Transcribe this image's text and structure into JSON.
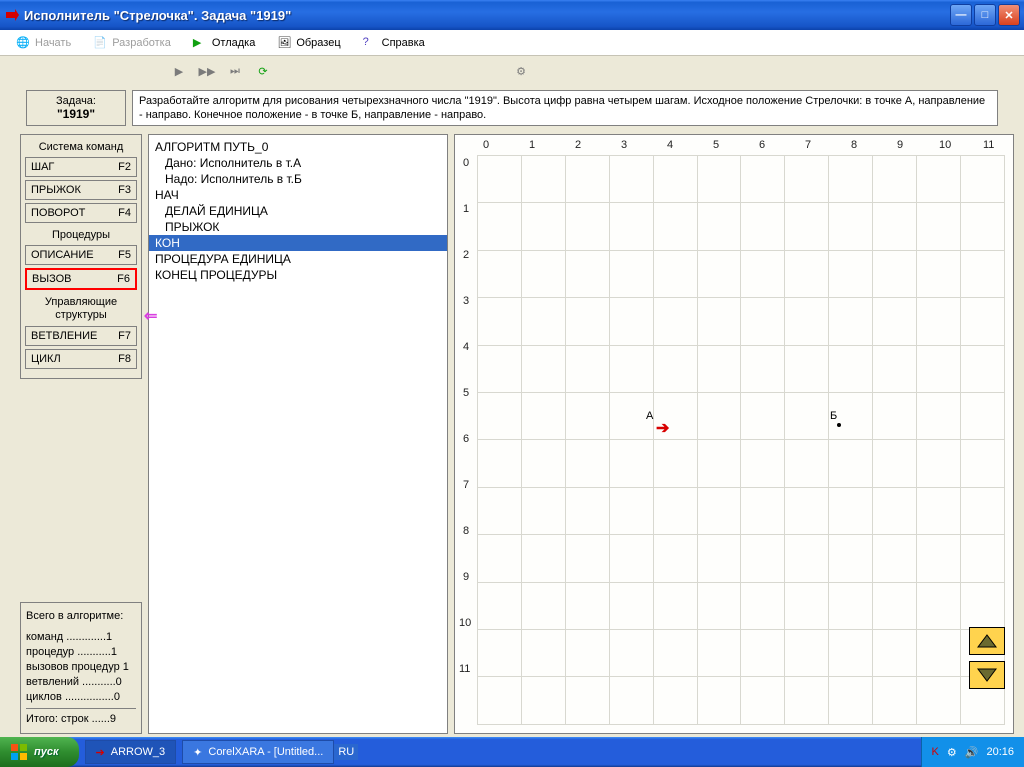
{
  "window": {
    "title": "Исполнитель \"Стрелочка\".  Задача  \"1919\""
  },
  "menu": {
    "начать": "Начать",
    "разработка": "Разработка",
    "отладка": "Отладка",
    "образец": "Образец",
    "справка": "Справка"
  },
  "task": {
    "label1": "Задача:",
    "label2": "\"1919\"",
    "text": "Разработайте алгоритм для рисования четырехзначного числа \"1919\". Высота цифр равна четырем шагам. Исходное положение Стрелочки: в точке А, направление - направо. Конечное положение - в  точке Б, направление - направо."
  },
  "commands": {
    "header": "Система команд",
    "шаг": {
      "name": "ШАГ",
      "key": "F2"
    },
    "прыжок": {
      "name": "ПРЫЖОК",
      "key": "F3"
    },
    "поворот": {
      "name": "ПОВОРОТ",
      "key": "F4"
    },
    "procHeader": "Процедуры",
    "описание": {
      "name": "ОПИСАНИЕ",
      "key": "F5"
    },
    "вызов": {
      "name": "ВЫЗОВ",
      "key": "F6"
    },
    "ctrlHeader": "Управляющие структуры",
    "ветвление": {
      "name": "ВЕТВЛЕНИЕ",
      "key": "F7"
    },
    "цикл": {
      "name": "ЦИКЛ",
      "key": "F8"
    }
  },
  "stats": {
    "title": "Всего в алгоритме:",
    "l1": "команд   .............1",
    "l2": "процедур   ...........1",
    "l3": "вызовов процедур 1",
    "l4": "ветвлений  ...........0",
    "l5": "циклов  ................0",
    "total": "Итого:  строк  ......9"
  },
  "code": {
    "l1": "АЛГОРИТМ ПУТЬ_0",
    "l2": "   Дано: Исполнитель в т.А",
    "l3": "   Надо: Исполнитель в т.Б",
    "l4": "НАЧ",
    "l5": "   ДЕЛАЙ ЕДИНИЦА",
    "l6": "   ПРЫЖОК",
    "l7": "КОН",
    "l8": "ПРОЦЕДУРА ЕДИНИЦА",
    "l9": "КОНЕЦ ПРОЦЕДУРЫ"
  },
  "grid": {
    "xlabels": [
      "0",
      "1",
      "2",
      "3",
      "4",
      "5",
      "6",
      "7",
      "8",
      "9",
      "10",
      "11"
    ],
    "ylabels": [
      "0",
      "1",
      "2",
      "3",
      "4",
      "5",
      "6",
      "7",
      "8",
      "9",
      "10",
      "11"
    ],
    "pointA": "А",
    "pointB": "Б"
  },
  "taskbar": {
    "start": "пуск",
    "task1": "ARROW_3",
    "task2": "CorelXARA - [Untitled...",
    "lang": "RU",
    "time": "20:16"
  }
}
